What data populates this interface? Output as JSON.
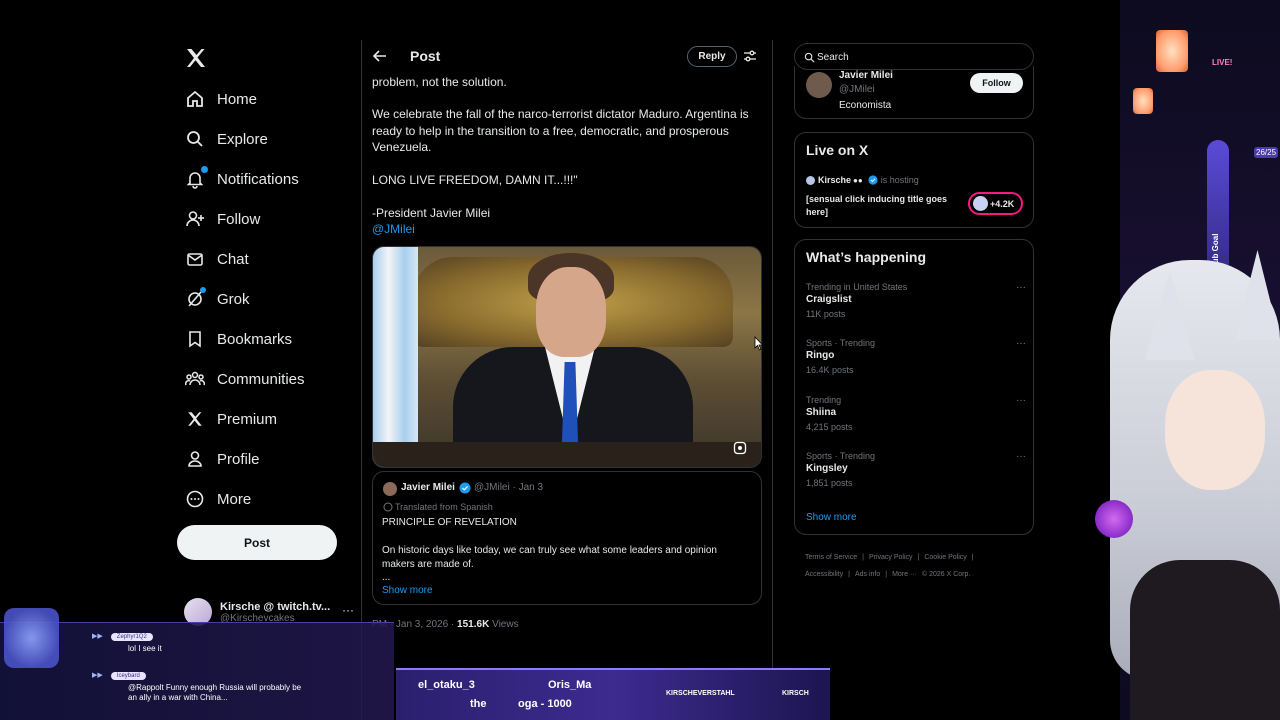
{
  "nav": {
    "items": [
      {
        "label": "Home",
        "icon": "home-icon"
      },
      {
        "label": "Explore",
        "icon": "search-icon"
      },
      {
        "label": "Notifications",
        "icon": "bell-icon"
      },
      {
        "label": "Follow",
        "icon": "follow-icon"
      },
      {
        "label": "Chat",
        "icon": "mail-icon"
      },
      {
        "label": "Grok",
        "icon": "grok-icon"
      },
      {
        "label": "Bookmarks",
        "icon": "bookmark-icon"
      },
      {
        "label": "Communities",
        "icon": "communities-icon"
      },
      {
        "label": "Premium",
        "icon": "x-logo-icon"
      },
      {
        "label": "Profile",
        "icon": "profile-icon"
      },
      {
        "label": "More",
        "icon": "more-icon"
      }
    ],
    "post_button": "Post",
    "account": {
      "name": "Kirsche @ twitch.tv...",
      "handle": "@Kirschevcakes",
      "more": "···"
    }
  },
  "header": {
    "title": "Post",
    "reply_label": "Reply"
  },
  "tweet": {
    "line1": "problem, not the solution.",
    "para2": "We celebrate the fall of the narco-terrorist dictator Maduro. Argentina is ready to help in the transition to a free, democratic, and prosperous Venezuela.",
    "para3": "LONG LIVE FREEDOM, DAMN IT...!!!\"",
    "signature": "-President Javier Milei",
    "mention": "@JMilei",
    "quote": {
      "name": "Javier Milei",
      "handle_date": "@JMilei · Jan 3",
      "translated": "Translated from Spanish",
      "line1": "PRINCIPLE OF REVELATION",
      "line2": "On historic days like today, we can truly see what some leaders and opinion makers are made of.",
      "ellipsis": "...",
      "show_more": "Show more"
    },
    "timestamp_prefix": "PM · Jan 3, 2026 · ",
    "views_count": "151.6K",
    "views_label": " Views"
  },
  "search": {
    "placeholder": "Search"
  },
  "who_to_follow": {
    "name": "Javier Milei",
    "handle": "@JMilei",
    "bio": "Economista",
    "follow_label": "Follow"
  },
  "live": {
    "title": "Live on X",
    "host": "Kirsche",
    "hosting": "is hosting",
    "description": "[sensual click inducing title goes here]",
    "count": "+4.2K"
  },
  "trends": {
    "title": "What’s happening",
    "items": [
      {
        "context": "Trending in United States",
        "name": "Craigslist",
        "posts": "11K posts"
      },
      {
        "context": "Sports · Trending",
        "name": "Ringo",
        "posts": "16.4K posts"
      },
      {
        "context": "Trending",
        "name": "Shiina",
        "posts": "4,215 posts"
      },
      {
        "context": "Sports · Trending",
        "name": "Kingsley",
        "posts": "1,851 posts"
      }
    ],
    "more_icon": "···",
    "show_more": "Show more"
  },
  "footer": {
    "links": [
      "Terms of Service",
      "|",
      "Privacy Policy",
      "|",
      "Cookie Policy",
      "|",
      "Accessibility",
      "|",
      "Ads info",
      "|",
      "More ···",
      "© 2026 X Corp."
    ]
  },
  "stream": {
    "live_sign": "LIVE!",
    "goal_label": "Daily Sub Goal",
    "goal_count": "26/25",
    "chat": [
      {
        "user": "Zephyr1Q2",
        "text": "lol I see it"
      },
      {
        "user": "Iceybard",
        "text": "@Rappolt Funny enough Russia will probably be an ally in a war with China..."
      }
    ],
    "ticker": [
      "el_otaku_3",
      "Oris_Ma",
      "the",
      "oga - 1000"
    ],
    "socials": [
      "KIRSCHEVERSTAHL",
      "KIRSCH"
    ]
  },
  "colors": {
    "accent": "#1d9bf0",
    "background": "#000000",
    "live_pink": "#f91880"
  }
}
